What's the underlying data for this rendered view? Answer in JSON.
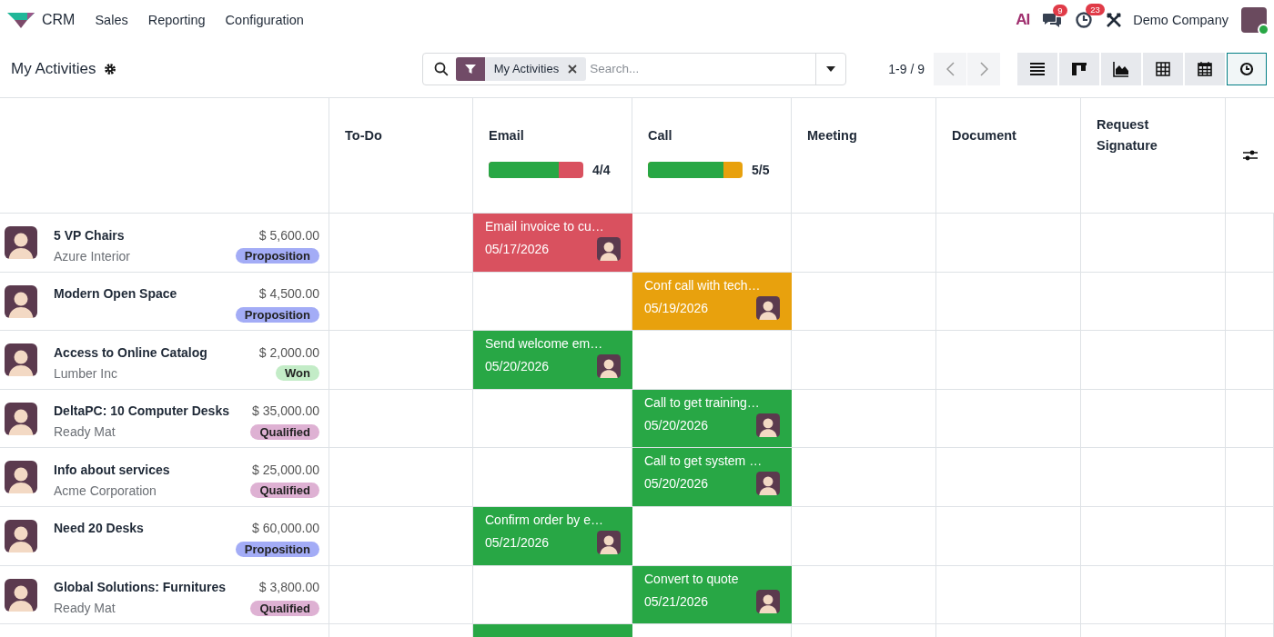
{
  "navbar": {
    "app": "CRM",
    "menus": [
      "Sales",
      "Reporting",
      "Configuration"
    ],
    "ai_label": "AI",
    "messages_badge": "9",
    "activities_badge": "23",
    "company": "Demo Company"
  },
  "control_panel": {
    "title": "My Activities",
    "facet": "My Activities",
    "search_placeholder": "Search...",
    "pager": "1-9 / 9",
    "views": [
      {
        "kind": "list",
        "selected": false
      },
      {
        "kind": "kanban",
        "selected": false
      },
      {
        "kind": "graph",
        "selected": false
      },
      {
        "kind": "pivot",
        "selected": false
      },
      {
        "kind": "calendar",
        "selected": false
      },
      {
        "kind": "activity",
        "selected": true
      }
    ]
  },
  "table": {
    "columns": [
      {
        "kind": "todo",
        "name": "To-Do"
      },
      {
        "kind": "email",
        "name": "Email",
        "count": "4/4",
        "color": "#d9515f",
        "progress": {
          "level": 0.74,
          "color": "#28a745"
        }
      },
      {
        "kind": "call",
        "name": "Call",
        "count": "5/5",
        "color": "#e8a10d",
        "progress": {
          "level": 0.8,
          "color": "#28a745"
        }
      },
      {
        "kind": "meeting",
        "name": "Meeting"
      },
      {
        "kind": "document",
        "name": "Document"
      },
      {
        "kind": "signature",
        "name": "Request Signature"
      }
    ],
    "rows": [
      {
        "name": "5 VP Chairs",
        "customer": "Azure Interior",
        "amount": "$ 5,600.00",
        "stage": {
          "label": "Proposition",
          "color": "#a3acf6"
        },
        "activities": [
          {
            "kind": "email",
            "color": "#d9515f",
            "title": "Email invoice to cu…",
            "date": "05/17/2026"
          }
        ]
      },
      {
        "name": "Modern Open Space",
        "amount": "$ 4,500.00",
        "stage": {
          "label": "Proposition",
          "color": "#a3acf6"
        },
        "activities": [
          {
            "kind": "call",
            "color": "#e8a10d",
            "title": "Conf call with tech…",
            "date": "05/19/2026"
          }
        ]
      },
      {
        "name": "Access to Online Catalog",
        "customer": "Lumber Inc",
        "amount": "$ 2,000.00",
        "stage": {
          "label": "Won",
          "color": "#c3ecc7"
        },
        "activities": [
          {
            "kind": "email",
            "color": "#28a745",
            "title": "Send welcome em…",
            "date": "05/20/2026"
          }
        ]
      },
      {
        "name": "DeltaPC: 10 Computer Desks",
        "customer": "Ready Mat",
        "amount": "$ 35,000.00",
        "stage": {
          "label": "Qualified",
          "color": "#deb1d3"
        },
        "activities": [
          {
            "kind": "call",
            "color": "#28a745",
            "title": "Call to get training…",
            "date": "05/20/2026"
          }
        ]
      },
      {
        "name": "Info about services",
        "customer": "Acme Corporation",
        "amount": "$ 25,000.00",
        "stage": {
          "label": "Qualified",
          "color": "#deb1d3"
        },
        "activities": [
          {
            "kind": "call",
            "color": "#28a745",
            "title": "Call to get system …",
            "date": "05/20/2026"
          }
        ]
      },
      {
        "name": "Need 20 Desks",
        "amount": "$ 60,000.00",
        "stage": {
          "label": "Proposition",
          "color": "#a3acf6"
        },
        "activities": [
          {
            "kind": "email",
            "color": "#28a745",
            "title": "Confirm order by e…",
            "date": "05/21/2026"
          }
        ]
      },
      {
        "name": "Global Solutions: Furnitures",
        "customer": "Ready Mat",
        "amount": "$ 3,800.00",
        "stage": {
          "label": "Qualified",
          "color": "#deb1d3"
        },
        "activities": [
          {
            "kind": "call",
            "color": "#28a745",
            "title": "Convert to quote",
            "date": "05/21/2026"
          }
        ]
      },
      {
        "activities": [
          {
            "kind": "email",
            "color": "#28a745"
          }
        ]
      }
    ]
  }
}
